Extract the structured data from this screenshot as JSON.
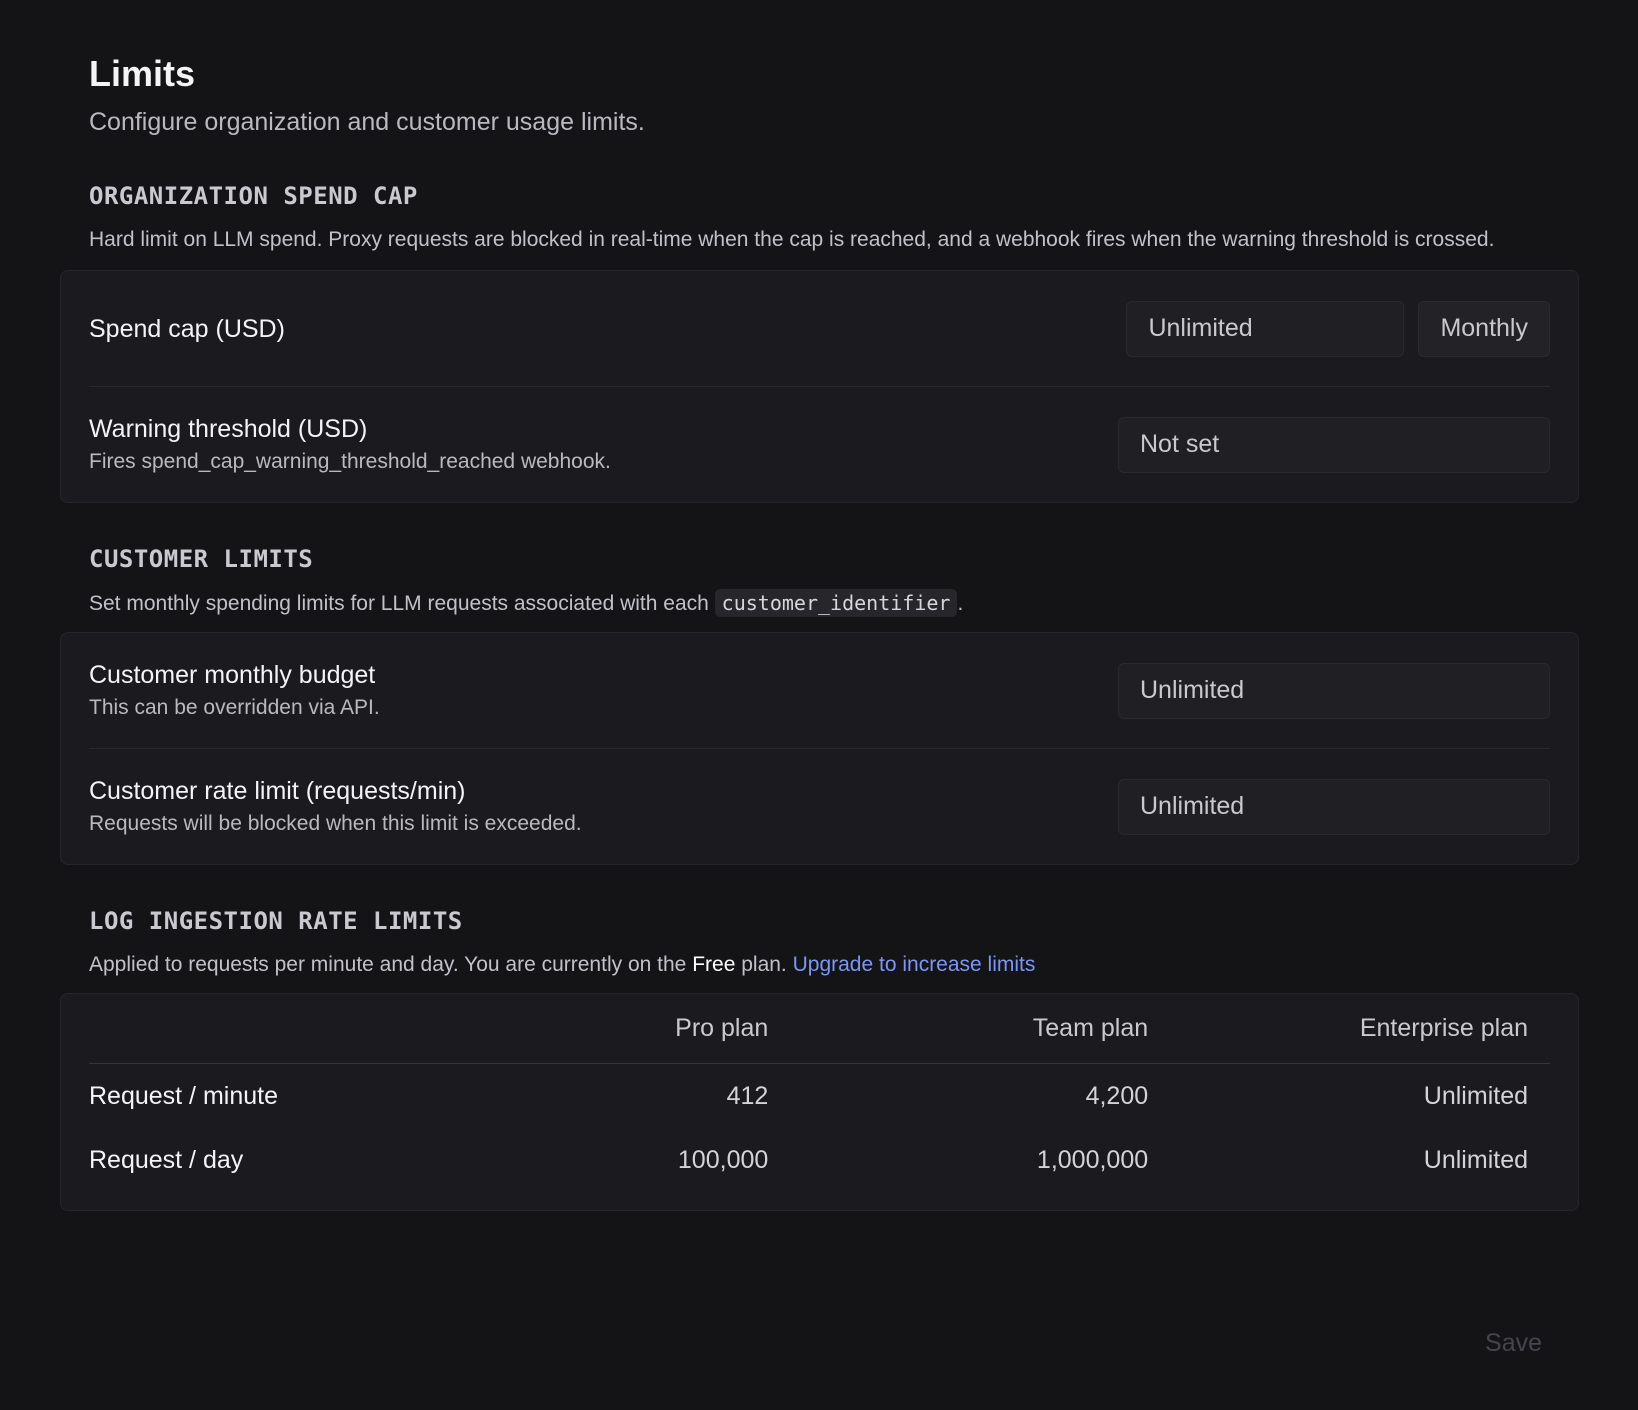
{
  "header": {
    "title": "Limits",
    "subtitle": "Configure organization and customer usage limits."
  },
  "org_spend_cap": {
    "heading": "ORGANIZATION SPEND CAP",
    "description": "Hard limit on LLM spend. Proxy requests are blocked in real-time when the cap is reached, and a webhook fires when the warning threshold is crossed.",
    "spend_cap": {
      "label": "Spend cap (USD)",
      "placeholder": "Unlimited",
      "period": "Monthly"
    },
    "warning_threshold": {
      "label": "Warning threshold (USD)",
      "help": "Fires spend_cap_warning_threshold_reached webhook.",
      "placeholder": "Not set"
    }
  },
  "customer_limits": {
    "heading": "CUSTOMER LIMITS",
    "description_prefix": "Set monthly spending limits for LLM requests associated with each",
    "description_code": "customer_identifier",
    "description_suffix": ".",
    "monthly_budget": {
      "label": "Customer monthly budget",
      "help": "This can be overridden via API.",
      "placeholder": "Unlimited"
    },
    "rate_limit": {
      "label": "Customer rate limit (requests/min)",
      "help": "Requests will be blocked when this limit is exceeded.",
      "placeholder": "Unlimited"
    }
  },
  "log_ingestion": {
    "heading": "LOG INGESTION RATE LIMITS",
    "description_prefix": "Applied to requests per minute and day. You are currently on the",
    "plan_name": "Free",
    "description_suffix": "plan.",
    "upgrade_link": "Upgrade to increase limits",
    "columns": [
      "Pro plan",
      "Team plan",
      "Enterprise plan"
    ],
    "rows": [
      {
        "label": "Request / minute",
        "values": [
          "412",
          "4,200",
          "Unlimited"
        ]
      },
      {
        "label": "Request / day",
        "values": [
          "100,000",
          "1,000,000",
          "Unlimited"
        ]
      }
    ]
  },
  "footer": {
    "save_label": "Save"
  }
}
